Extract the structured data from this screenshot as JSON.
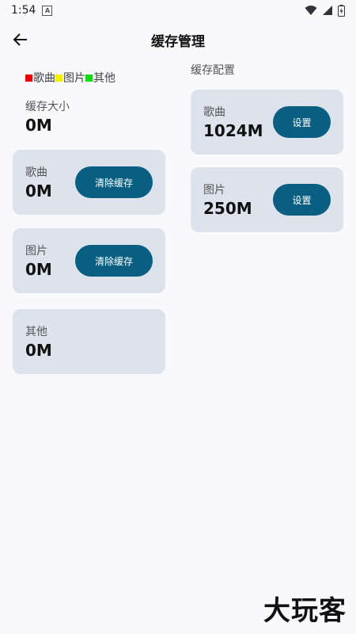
{
  "status_bar": {
    "time": "1:54",
    "notification_glyph": "A"
  },
  "header": {
    "title": "缓存管理"
  },
  "legend": [
    {
      "label": "歌曲",
      "color": "#e60000"
    },
    {
      "label": "图片",
      "color": "#f2f200"
    },
    {
      "label": "其他",
      "color": "#14d814"
    }
  ],
  "total": {
    "label": "缓存大小",
    "value": "0M"
  },
  "cache_items": [
    {
      "label": "歌曲",
      "value": "0M",
      "button": "清除缓存"
    },
    {
      "label": "图片",
      "value": "0M",
      "button": "清除缓存"
    },
    {
      "label": "其他",
      "value": "0M"
    }
  ],
  "config": {
    "title": "缓存配置",
    "items": [
      {
        "label": "歌曲",
        "value": "1024M",
        "button": "设置"
      },
      {
        "label": "图片",
        "value": "250M",
        "button": "设置"
      }
    ]
  },
  "watermark": "大玩客",
  "colors": {
    "card_bg": "#dde3ec",
    "button_bg": "#085f82"
  }
}
